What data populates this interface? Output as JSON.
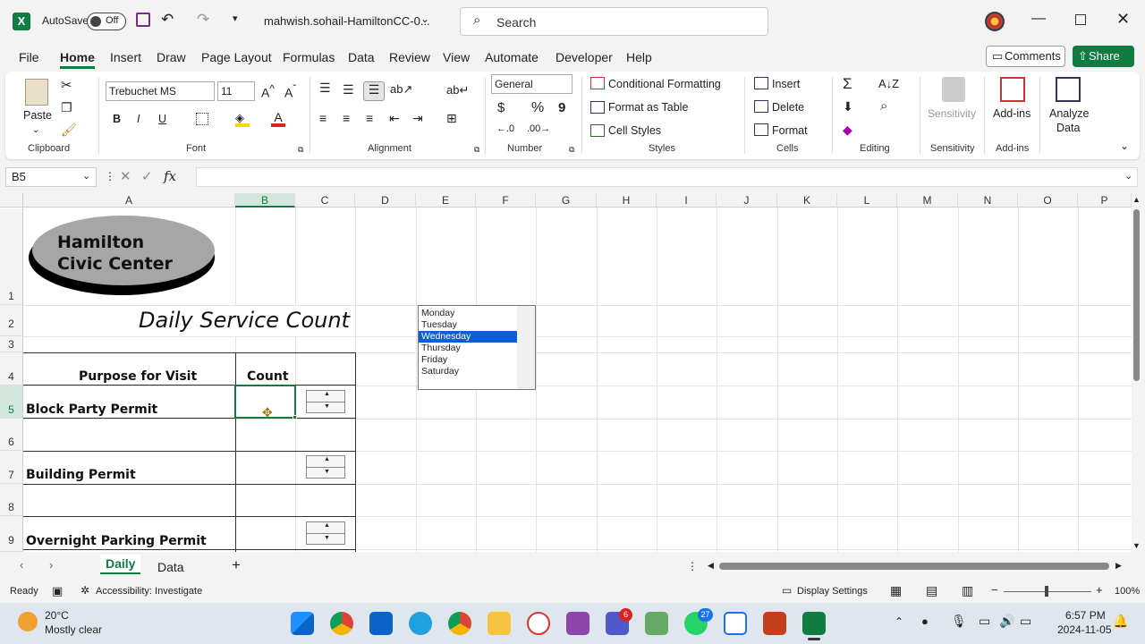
{
  "titlebar": {
    "autosave_label": "AutoSave",
    "autosave_state": "Off",
    "filename": "mahwish.sohail-HamiltonCC-0...",
    "search_placeholder": "Search"
  },
  "menu": {
    "tabs": [
      "File",
      "Home",
      "Insert",
      "Draw",
      "Page Layout",
      "Formulas",
      "Data",
      "Review",
      "View",
      "Automate",
      "Developer",
      "Help"
    ],
    "active": "Home",
    "comments_label": "Comments",
    "share_label": "Share"
  },
  "ribbon": {
    "clipboard": {
      "paste": "Paste",
      "label": "Clipboard"
    },
    "font": {
      "name": "Trebuchet MS",
      "size": "11",
      "bold": "B",
      "italic": "I",
      "underline": "U",
      "label": "Font"
    },
    "alignment": {
      "label": "Alignment"
    },
    "number": {
      "format": "General",
      "dollar": "$",
      "percent": "%",
      "comma": "9",
      "label": "Number"
    },
    "styles": {
      "conditional": "Conditional Formatting",
      "format_table": "Format as Table",
      "cell_styles": "Cell Styles",
      "label": "Styles"
    },
    "cells": {
      "insert": "Insert",
      "delete": "Delete",
      "format": "Format",
      "label": "Cells"
    },
    "editing": {
      "label": "Editing"
    },
    "sensitivity": {
      "button": "Sensitivity",
      "label": "Sensitivity"
    },
    "addins": {
      "button": "Add-ins",
      "label": "Add-ins"
    },
    "analyze": {
      "line1": "Analyze",
      "line2": "Data"
    }
  },
  "formula_bar": {
    "name_box": "B5",
    "fx": "fx",
    "value": ""
  },
  "sheet": {
    "columns": [
      "A",
      "B",
      "C",
      "D",
      "E",
      "F",
      "G",
      "H",
      "I",
      "J",
      "K",
      "L",
      "M",
      "N",
      "O",
      "P"
    ],
    "selected_column": "B",
    "rows": [
      "1",
      "2",
      "3",
      "4",
      "5",
      "6",
      "7",
      "8",
      "9"
    ],
    "selected_row": "5",
    "logo_line1": "Hamilton",
    "logo_line2": "Civic Center",
    "title": "Daily Service Count",
    "header_purpose": "Purpose for Visit",
    "header_count": "Count",
    "items": [
      "Block Party Permit",
      "Building Permit",
      "Overnight Parking Permit"
    ],
    "listbox_items": [
      "Monday",
      "Tuesday",
      "Wednesday",
      "Thursday",
      "Friday",
      "Saturday"
    ],
    "listbox_selected": "Wednesday"
  },
  "sheet_tabs": {
    "tabs": [
      "Daily",
      "Data"
    ],
    "active": "Daily",
    "add": "+"
  },
  "status_bar": {
    "ready": "Ready",
    "accessibility": "Accessibility: Investigate",
    "display_settings": "Display Settings",
    "zoom": "100%"
  },
  "taskbar": {
    "weather_temp": "20°C",
    "weather_desc": "Mostly clear",
    "time": "6:57 PM",
    "date": "2024-11-05",
    "badge_red": "6",
    "badge_whatsapp": "27"
  },
  "colors": {
    "excel_green": "#107c41",
    "selection_blue": "#0b5ed7"
  }
}
